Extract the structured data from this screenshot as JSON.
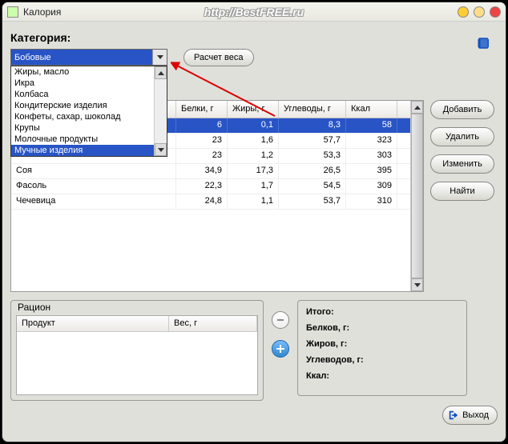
{
  "window": {
    "title": "Калория",
    "watermark": "http://BestFREE.ru"
  },
  "category": {
    "label": "Категория:",
    "selected": "Бобовые",
    "options": [
      "Жиры, масло",
      "Икра",
      "Колбаса",
      "Кондитерские изделия",
      "Конфеты, сахар, шоколад",
      "Крупы",
      "Молочные продукты",
      "Мучные изделия"
    ],
    "highlighted_index": 7
  },
  "buttons": {
    "calc": "Расчет веса",
    "add": "Добавить",
    "del": "Удалить",
    "edit": "Изменить",
    "find": "Найти",
    "exit": "Выход"
  },
  "table": {
    "headers": {
      "name": "",
      "prot": "Белки, г",
      "fat": "Жиры, г",
      "carb": "Углеводы, г",
      "kcal": "Ккал"
    },
    "rows": [
      {
        "name": "",
        "prot": "6",
        "fat": "0,1",
        "carb": "8,3",
        "kcal": "58",
        "sel": true
      },
      {
        "name": "",
        "prot": "23",
        "fat": "1,6",
        "carb": "57,7",
        "kcal": "323"
      },
      {
        "name": "",
        "prot": "23",
        "fat": "1,2",
        "carb": "53,3",
        "kcal": "303"
      },
      {
        "name": "Соя",
        "prot": "34,9",
        "fat": "17,3",
        "carb": "26,5",
        "kcal": "395"
      },
      {
        "name": "Фасоль",
        "prot": "22,3",
        "fat": "1,7",
        "carb": "54,5",
        "kcal": "309"
      },
      {
        "name": "Чечевица",
        "prot": "24,8",
        "fat": "1,1",
        "carb": "53,7",
        "kcal": "310"
      }
    ]
  },
  "ration": {
    "title": "Рацион",
    "headers": {
      "product": "Продукт",
      "weight": "Вес, г"
    }
  },
  "summary": {
    "total": "Итого:",
    "prot": "Белков, г:",
    "fat": "Жиров, г:",
    "carb": "Углеводов, г:",
    "kcal": "Ккал:"
  }
}
